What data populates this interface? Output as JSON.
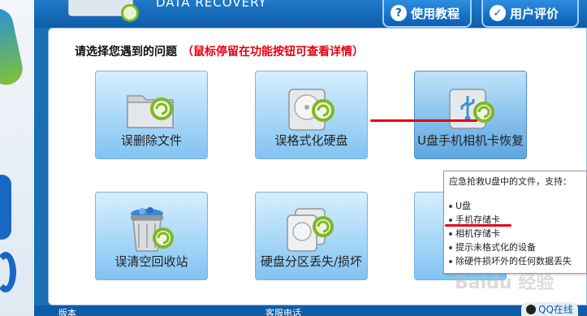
{
  "header": {
    "brand_text": "DATA RECOVERY",
    "tutorial_label": "使用教程",
    "review_label": "用户评价"
  },
  "main": {
    "prompt": "请选择您遇到的问题",
    "hint": "（鼠标停留在功能按钮可查看详情）",
    "tiles": [
      {
        "label": "误删除文件",
        "icon": "folder-recover-icon"
      },
      {
        "label": "误格式化硬盘",
        "icon": "harddisk-recover-icon"
      },
      {
        "label": "U盘手机相机卡恢复",
        "icon": "usb-recover-icon"
      },
      {
        "label": "误清空回收站",
        "icon": "recycle-bin-icon"
      },
      {
        "label": "硬盘分区丢失/损坏",
        "icon": "partition-recover-icon"
      }
    ]
  },
  "tooltip": {
    "heading": "应急抢救U盘中的文件，支持：",
    "items": [
      "U盘",
      "手机存储卡",
      "相机存储卡",
      "提示未格式化的设备",
      "除硬件损坏外的任何数据丢失"
    ]
  },
  "footer": {
    "version_label": "版本",
    "hotline_label": "客服电话",
    "qq_label": "QQ在线"
  },
  "watermark": "Baidu 经验",
  "colors": {
    "accent": "#0f5da8",
    "highlight": "#e60012",
    "tile": "#a7d7f8"
  }
}
